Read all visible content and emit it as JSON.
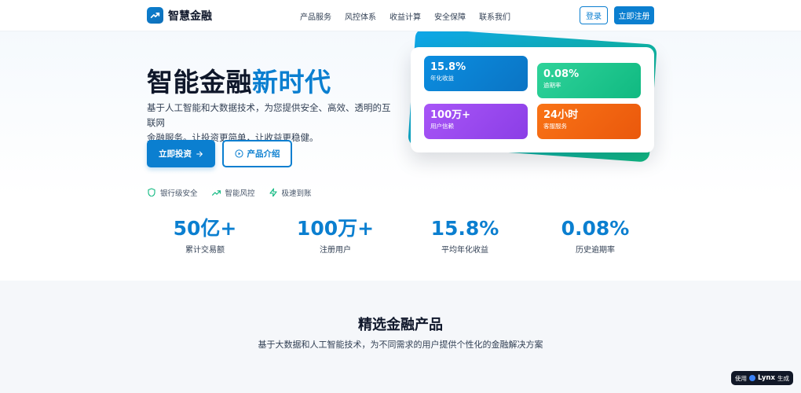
{
  "header": {
    "logo_text": "智慧金融",
    "nav": [
      "产品服务",
      "风控体系",
      "收益计算",
      "安全保障",
      "联系我们"
    ],
    "login_label": "登录",
    "register_label": "立即注册"
  },
  "hero": {
    "title_main": "智能金融",
    "title_highlight": "新时代",
    "desc_line1": "基于人工智能和大数据技术，为您提供安全、高效、透明的互联网",
    "desc_line2": "金融服务。让投资更简单，让收益更稳健。",
    "cta_primary": "立即投资",
    "cta_secondary": "产品介绍",
    "features": [
      "银行级安全",
      "智能风控",
      "极速到账"
    ]
  },
  "tiles": [
    {
      "value": "15.8%",
      "label": "年化收益"
    },
    {
      "value": "0.08%",
      "label": "逾期率"
    },
    {
      "value": "100万+",
      "label": "用户信赖"
    },
    {
      "value": "24小时",
      "label": "客服服务"
    }
  ],
  "stats": [
    {
      "value": "50亿+",
      "label": "累计交易额"
    },
    {
      "value": "100万+",
      "label": "注册用户"
    },
    {
      "value": "15.8%",
      "label": "平均年化收益"
    },
    {
      "value": "0.08%",
      "label": "历史逾期率"
    }
  ],
  "products": {
    "title": "精选金融产品",
    "subtitle": "基于大数据和人工智能技术，为不同需求的用户提供个性化的金融解决方案"
  },
  "badge": {
    "prefix": "使用",
    "brand": "Lynx",
    "suffix": "生成"
  },
  "colors": {
    "accent": "#0b7fd0",
    "green": "#10b981",
    "purple": "#8b3ee6",
    "orange": "#ea580c"
  }
}
